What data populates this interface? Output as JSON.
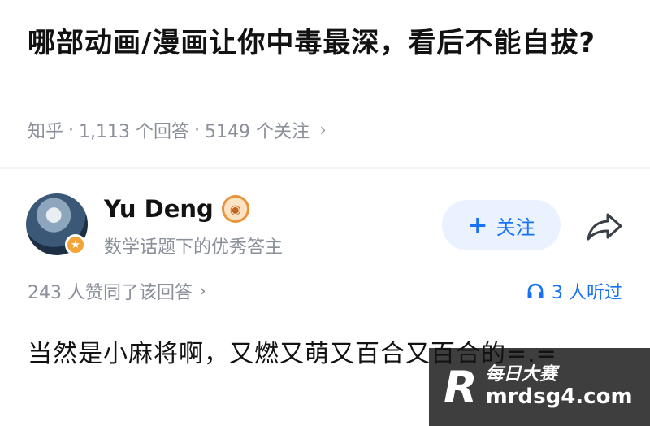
{
  "question": {
    "title": "哪部动画/漫画让你中毒最深，看后不能自拔?",
    "source": "知乎",
    "answers": "1,113 个回答",
    "followers": "5149 个关注",
    "separator": "·"
  },
  "author": {
    "name": "Yu Deng",
    "description": "数学话题下的优秀答主",
    "follow_label": "关注"
  },
  "answer": {
    "votes": "243 人赞同了该回答",
    "listeners": "3 人听过",
    "content": "当然是小麻将啊，又燃又萌又百合又百合的=.="
  },
  "colors": {
    "accent": "#1772f6",
    "follow_bg": "#eaf2ff",
    "muted": "#8a8f99"
  }
}
